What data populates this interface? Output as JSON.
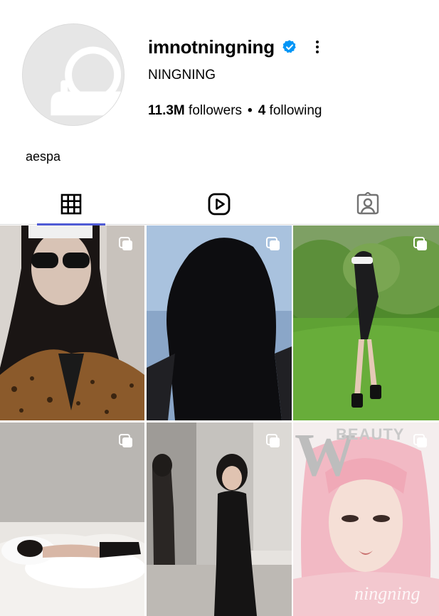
{
  "profile": {
    "username": "imnotningning",
    "full_name": "NINGNING",
    "followers_count": "11.3M",
    "followers_label": "followers",
    "following_count": "4",
    "following_label": "following",
    "separator": "•",
    "bio": "aespa",
    "verified": true
  },
  "icons": {
    "verified": "verified-badge-icon",
    "more": "more-options-icon",
    "grid_tab": "grid-icon",
    "reels_tab": "reels-icon",
    "tagged_tab": "tagged-icon",
    "carousel": "carousel-icon"
  },
  "tabs": [
    {
      "name": "posts",
      "icon": "grid-icon",
      "active": true
    },
    {
      "name": "reels",
      "icon": "reels-icon",
      "active": false
    },
    {
      "name": "tagged",
      "icon": "tagged-icon",
      "active": false
    }
  ],
  "posts": [
    {
      "carousel": true
    },
    {
      "carousel": true
    },
    {
      "carousel": true
    },
    {
      "carousel": true
    },
    {
      "carousel": true
    },
    {
      "carousel": true,
      "overlay_brand": "W",
      "overlay_subtitle": "BEAUTY",
      "overlay_signature": "ningning"
    }
  ],
  "colors": {
    "verified_blue": "#0095f6",
    "active_tab_indicator": "#4f5bd5",
    "divider": "#dbdbdb",
    "text": "#000000"
  }
}
